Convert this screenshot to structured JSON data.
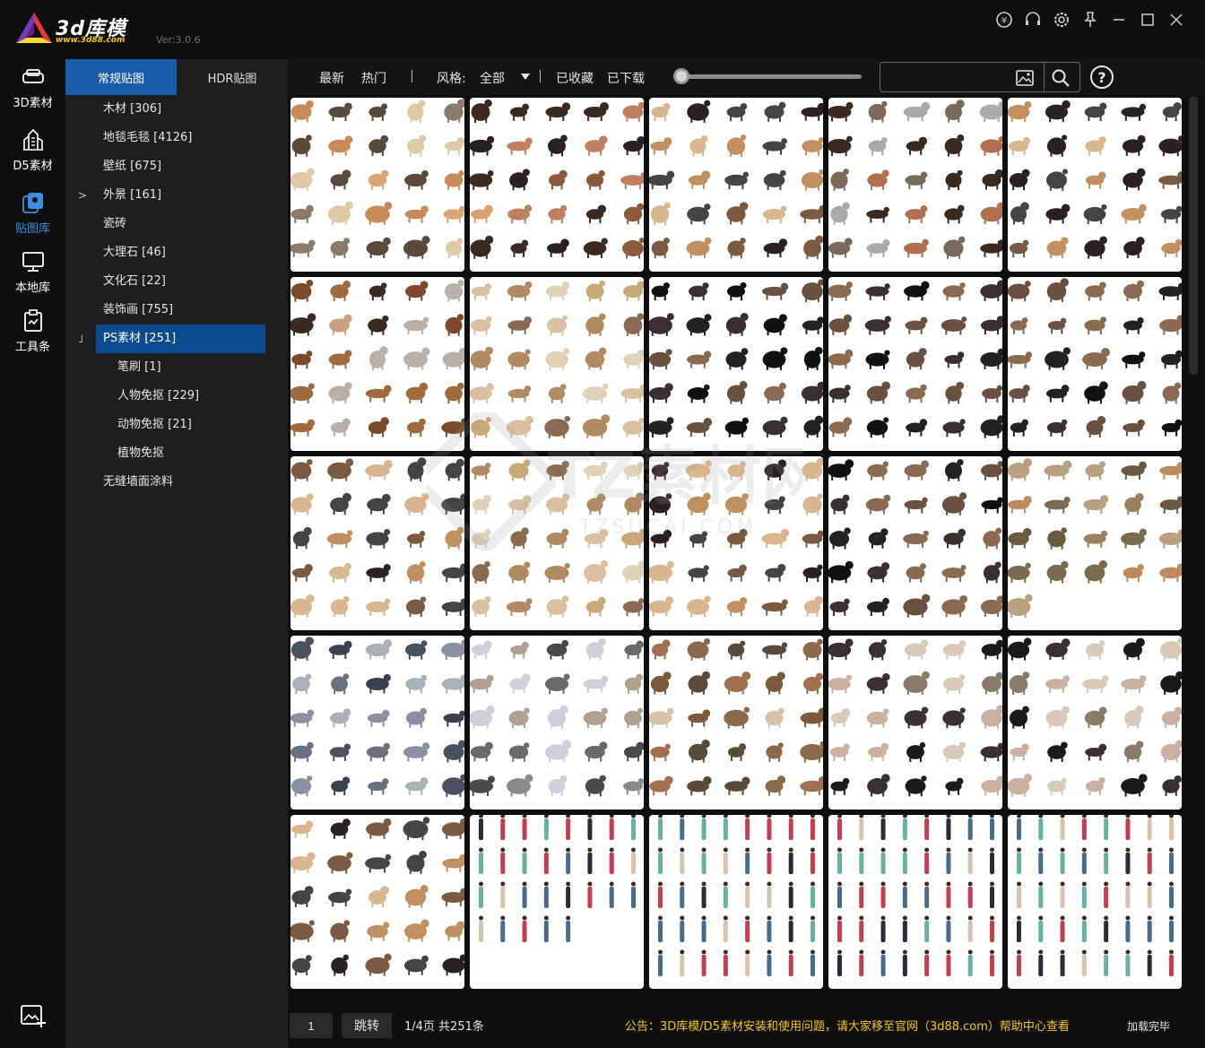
{
  "app": {
    "logo_text": "3d库模",
    "logo_url": "www.3d88.com",
    "version": "Ver:3.0.6"
  },
  "window_controls": [
    "coin-icon",
    "headset-icon",
    "gear-icon",
    "pin-icon",
    "minimize-icon",
    "maximize-icon",
    "close-icon"
  ],
  "rail": {
    "items": [
      {
        "label": "3D素材",
        "icon": "sofa-icon",
        "active": false
      },
      {
        "label": "D5素材",
        "icon": "building-icon",
        "active": false
      },
      {
        "label": "贴图库",
        "icon": "layers-icon",
        "active": true
      },
      {
        "label": "本地库",
        "icon": "monitor-icon",
        "active": false
      },
      {
        "label": "工具条",
        "icon": "clipboard-icon",
        "active": false
      }
    ],
    "bottom_icon": "image-add-icon"
  },
  "category_tabs": [
    {
      "label": "常规贴图",
      "active": true
    },
    {
      "label": "HDR贴图",
      "active": false
    }
  ],
  "categories": [
    {
      "label": "木材 [306]",
      "level": 0,
      "arrow": ""
    },
    {
      "label": "地毯毛毯 [4126]",
      "level": 0,
      "arrow": ""
    },
    {
      "label": "壁纸 [675]",
      "level": 0,
      "arrow": ""
    },
    {
      "label": "外景 [161]",
      "level": 0,
      "arrow": ">"
    },
    {
      "label": "瓷砖",
      "level": 0,
      "arrow": ""
    },
    {
      "label": "大理石 [46]",
      "level": 0,
      "arrow": ""
    },
    {
      "label": "文化石 [22]",
      "level": 0,
      "arrow": ""
    },
    {
      "label": "装饰画 [755]",
      "level": 0,
      "arrow": ""
    },
    {
      "label": "PS素材 [251]",
      "level": 0,
      "arrow": "˩",
      "active": true
    },
    {
      "label": "笔刷 [1]",
      "level": 1,
      "arrow": ""
    },
    {
      "label": "人物免抠 [229]",
      "level": 1,
      "arrow": ""
    },
    {
      "label": "动物免抠 [21]",
      "level": 1,
      "arrow": ""
    },
    {
      "label": "植物免抠",
      "level": 1,
      "arrow": ""
    },
    {
      "label": "无缝墙面涂料",
      "level": 0,
      "arrow": ""
    }
  ],
  "toolbar": {
    "latest": "最新",
    "popular": "热门",
    "style_label": "风格:",
    "style_value": "全部",
    "favorited": "已收藏",
    "downloaded": "已下载",
    "search_placeholder": "",
    "help": "?",
    "zoom_level": 0.0
  },
  "thumbnails": [
    {
      "theme": "cats-lizards"
    },
    {
      "theme": "dogs-lizards"
    },
    {
      "theme": "dogs-mixed"
    },
    {
      "theme": "cats-dogs"
    },
    {
      "theme": "dogs-mixed"
    },
    {
      "theme": "dogs-cats"
    },
    {
      "theme": "dogs-light"
    },
    {
      "theme": "dogs-dark"
    },
    {
      "theme": "dogs-dark"
    },
    {
      "theme": "dogs-dark"
    },
    {
      "theme": "dogs-mixed"
    },
    {
      "theme": "dogs-light"
    },
    {
      "theme": "dogs-mixed"
    },
    {
      "theme": "dogs-dark"
    },
    {
      "theme": "reptiles-birds"
    },
    {
      "theme": "pigeons"
    },
    {
      "theme": "birds"
    },
    {
      "theme": "cats-ducks"
    },
    {
      "theme": "cats"
    },
    {
      "theme": "cats"
    },
    {
      "theme": "dogs-mixed"
    },
    {
      "theme": "people"
    },
    {
      "theme": "people"
    },
    {
      "theme": "people"
    },
    {
      "theme": "people"
    }
  ],
  "footer": {
    "page_value": "1",
    "jump_label": "跳转",
    "page_info": "1/4页 共251条",
    "notice": "公告：3D库模/D5素材安装和使用问题，请大家移至官网（3d88.com）帮助中心查看",
    "load_status": "加载完毕"
  },
  "watermark": {
    "text": "TZ素材网",
    "subtext": "TZSUCAI.COM"
  },
  "colors": {
    "accent": "#1a5ca8",
    "active_item": "#0c4a8f",
    "rail_active": "#3b8fe0",
    "notice": "#f5c518"
  }
}
